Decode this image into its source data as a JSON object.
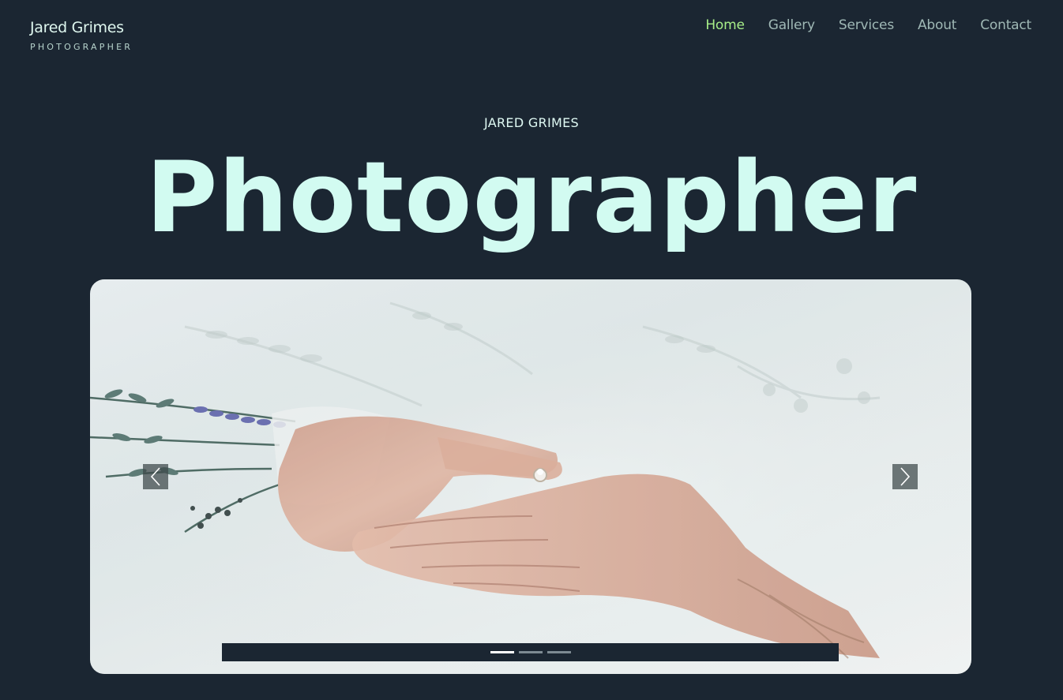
{
  "brand": {
    "name": "Jared Grimes",
    "subtitle": "PHOTOGRAPHER"
  },
  "nav": {
    "items": [
      {
        "label": "Home",
        "active": true
      },
      {
        "label": "Gallery",
        "active": false
      },
      {
        "label": "Services",
        "active": false
      },
      {
        "label": "About",
        "active": false
      },
      {
        "label": "Contact",
        "active": false
      }
    ]
  },
  "hero": {
    "kicker": "JARED GRIMES",
    "headline": "Photographer"
  },
  "slider": {
    "prev_icon": "chevron-left-icon",
    "next_icon": "chevron-right-icon",
    "slide_count": 3,
    "active_slide": 1
  },
  "colors": {
    "background": "#1b2632",
    "accent_active_nav": "#a7ee88",
    "headline": "#d2fbf1"
  }
}
